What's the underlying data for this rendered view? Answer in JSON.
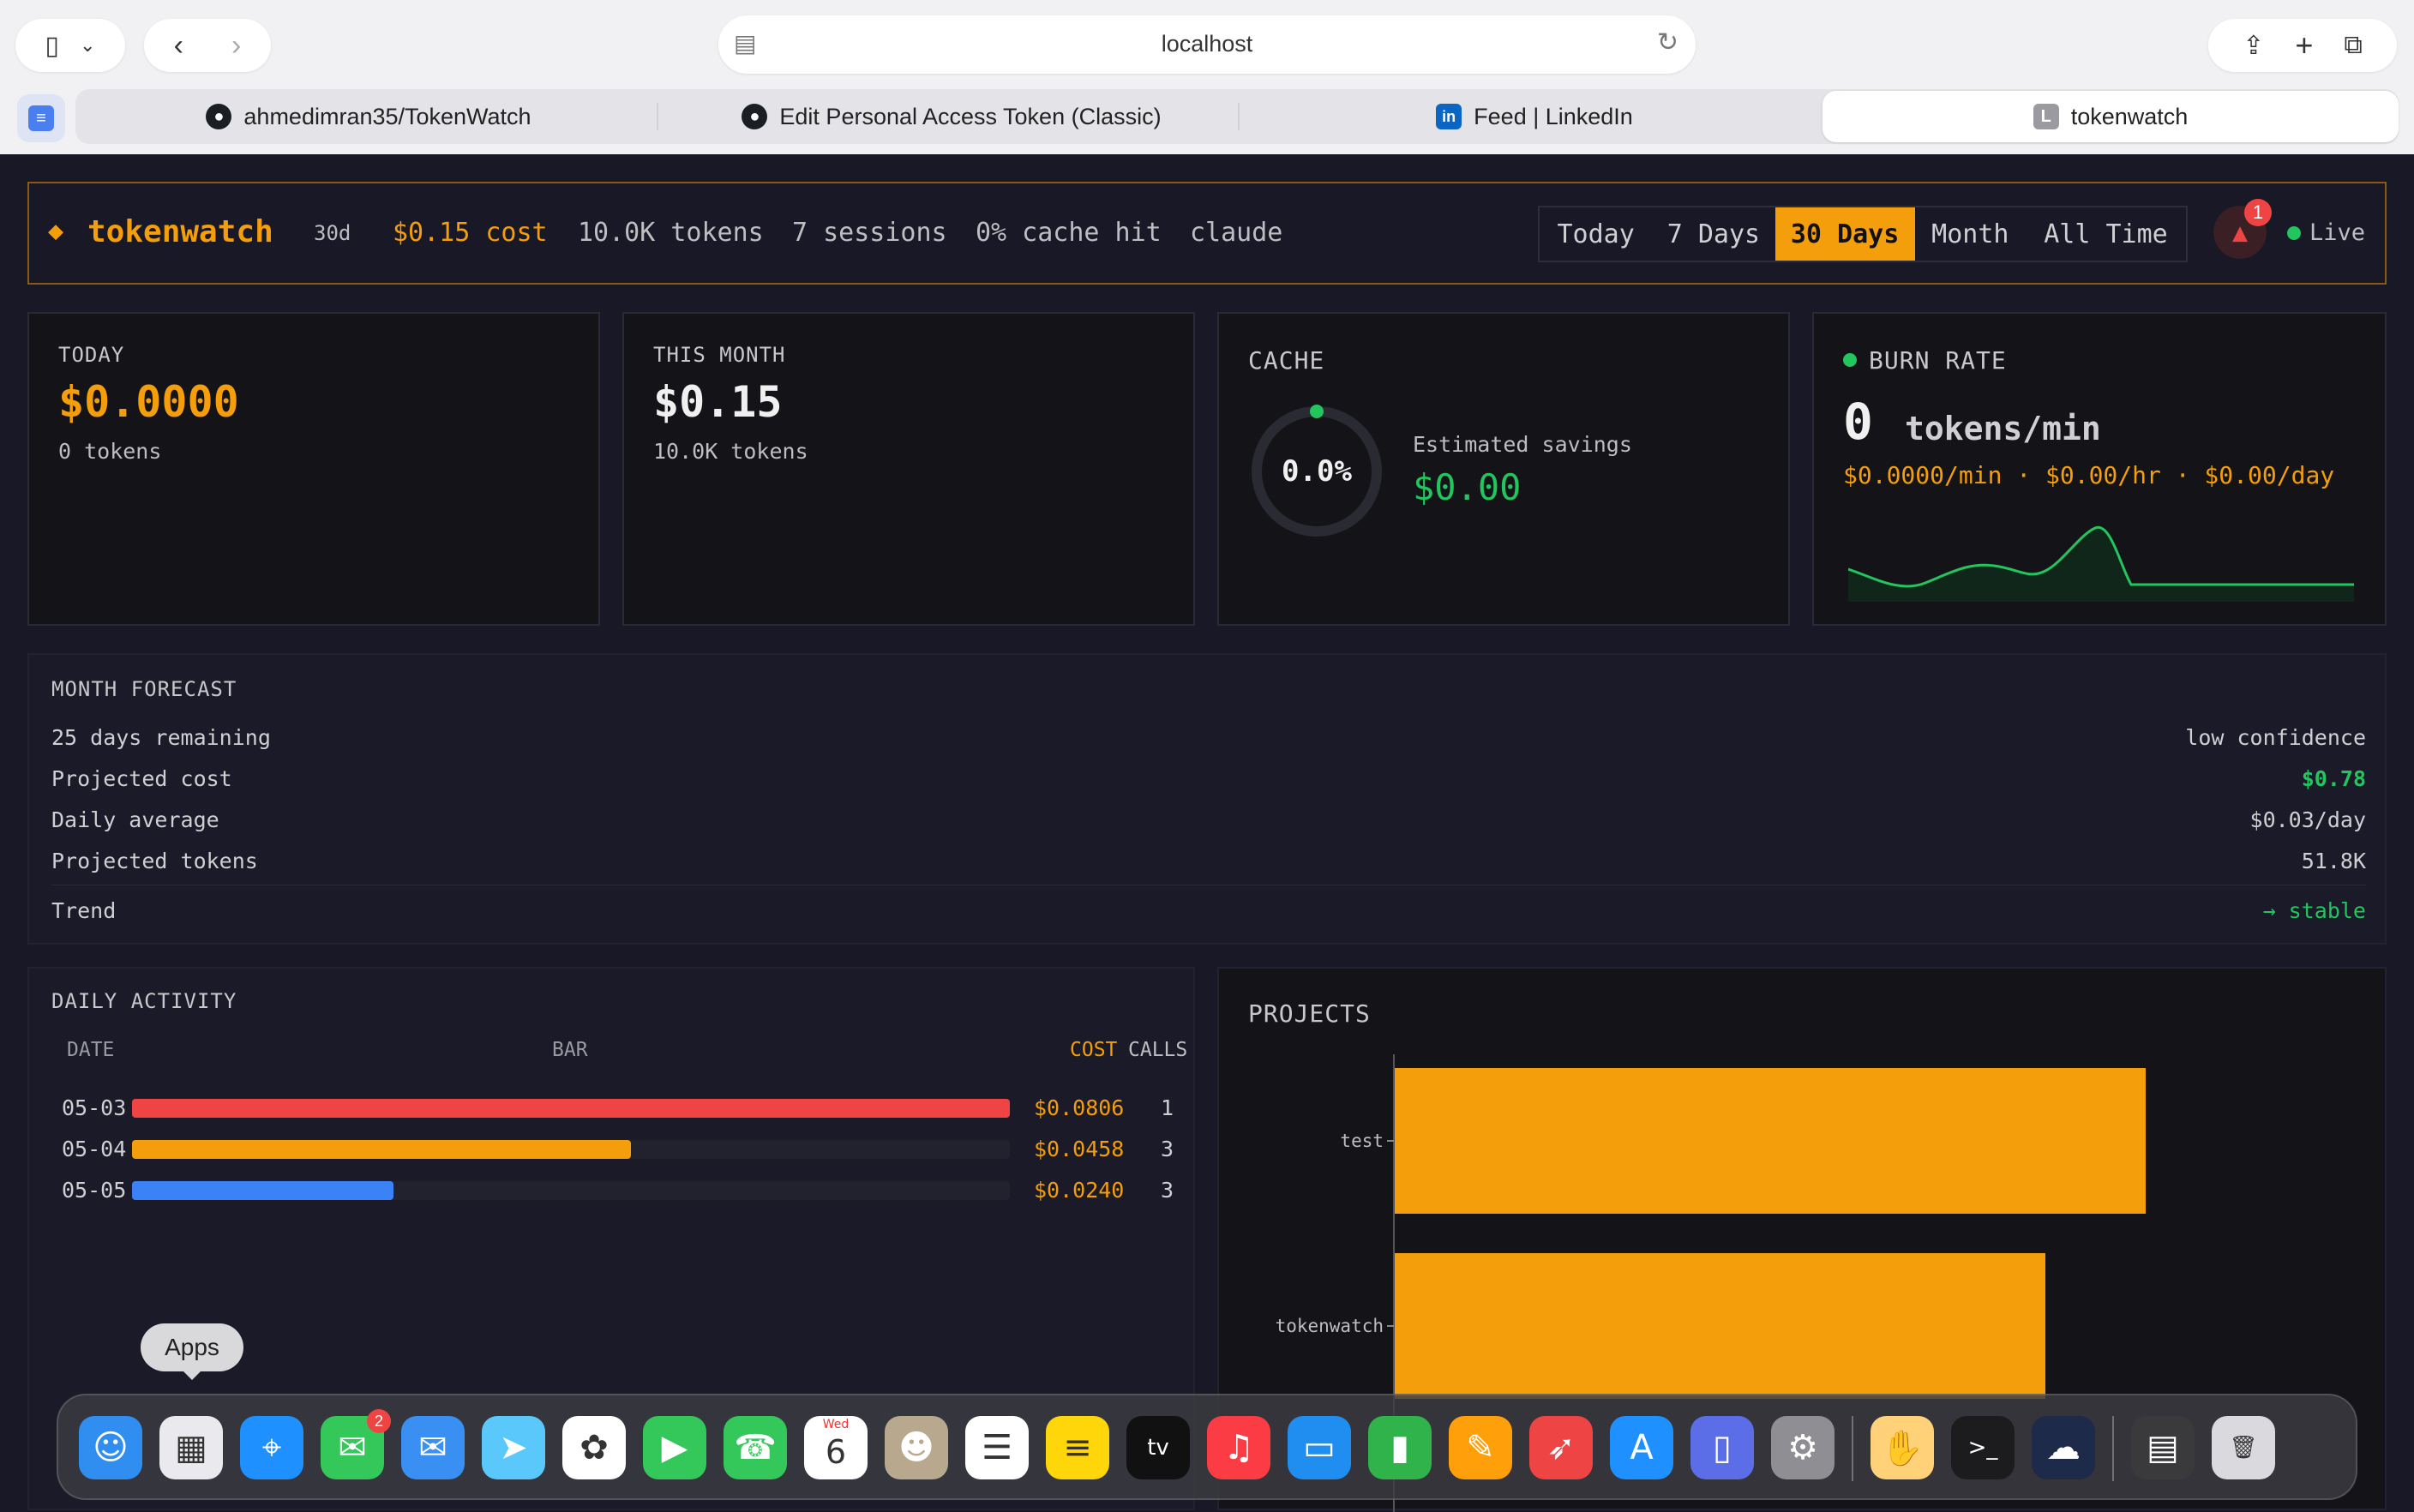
{
  "browser": {
    "url": "localhost",
    "tabs": [
      {
        "label": "ahmedimran35/TokenWatch",
        "icon": "github-icon"
      },
      {
        "label": "Edit Personal Access Token (Classic)",
        "icon": "github-icon"
      },
      {
        "label": "Feed | LinkedIn",
        "icon": "linkedin-icon"
      },
      {
        "label": "tokenwatch",
        "icon": "letter-l-icon",
        "icon_letter": "L",
        "active": true
      }
    ]
  },
  "header": {
    "logo_symbol": "◆",
    "brand": "tokenwatch",
    "period": "30d",
    "cost": "$0.15 cost",
    "tokens": "10.0K tokens",
    "sessions": "7 sessions",
    "cache_hit": "0% cache hit",
    "provider": "claude",
    "ranges": [
      "Today",
      "7 Days",
      "30 Days",
      "Month",
      "All Time"
    ],
    "active_range": "30 Days",
    "alert_count": "1",
    "live_label": "Live"
  },
  "cards": {
    "today": {
      "label": "TODAY",
      "value": "$0.0000",
      "sub": "0 tokens"
    },
    "month": {
      "label": "THIS MONTH",
      "value": "$0.15",
      "sub": "10.0K tokens"
    },
    "cache": {
      "label": "CACHE",
      "gauge": "0.0%",
      "gauge_fraction": 0.0,
      "savings_label": "Estimated savings",
      "savings_value": "$0.00"
    },
    "burn": {
      "label": "BURN RATE",
      "value": "0",
      "unit": "tokens/min",
      "rates": "$0.0000/min · $0.00/hr · $0.00/day"
    }
  },
  "forecast": {
    "title": "MONTH FORECAST",
    "rows": [
      {
        "left": "25 days remaining",
        "right": "low confidence"
      },
      {
        "left": "Projected cost",
        "right": "$0.78"
      },
      {
        "left": "Daily average",
        "right": "$0.03/day"
      },
      {
        "left": "Projected tokens",
        "right": "51.8K"
      },
      {
        "left": "Trend",
        "right": "→ stable"
      }
    ]
  },
  "daily": {
    "title": "DAILY ACTIVITY",
    "columns": {
      "date": "DATE",
      "bar": "BAR",
      "cost": "COST",
      "calls": "CALLS"
    },
    "rows": [
      {
        "date": "05-03",
        "cost": "$0.0806",
        "calls": "1",
        "fraction": 1.0,
        "color": "#ef4444"
      },
      {
        "date": "05-04",
        "cost": "$0.0458",
        "calls": "3",
        "fraction": 0.568,
        "color": "#f59e0b"
      },
      {
        "date": "05-05",
        "cost": "$0.0240",
        "calls": "3",
        "fraction": 0.298,
        "color": "#3b82f6"
      }
    ]
  },
  "projects": {
    "title": "PROJECTS"
  },
  "chart_data": {
    "type": "bar",
    "orientation": "horizontal",
    "categories": [
      "test",
      "tokenwatch"
    ],
    "values": [
      1.0,
      0.867
    ],
    "color": "#f59e0b"
  },
  "colors": {
    "accent": "#f59e0b",
    "green": "#22c55e",
    "red": "#ef4444",
    "blue": "#3b82f6"
  },
  "dock": {
    "tooltip": "Apps",
    "apps": [
      {
        "name": "finder-icon",
        "glyph": "☺",
        "bg": "#2f8ef0"
      },
      {
        "name": "launchpad-icon",
        "glyph": "▦",
        "bg": "#e9e9ee"
      },
      {
        "name": "safari-icon",
        "glyph": "⌖",
        "bg": "#1e90ff"
      },
      {
        "name": "messages-icon",
        "glyph": "✉",
        "bg": "#34c759",
        "badge": "2"
      },
      {
        "name": "mail-icon",
        "glyph": "✉",
        "bg": "#3a8ff2"
      },
      {
        "name": "maps-icon",
        "glyph": "➤",
        "bg": "#5ac8fa"
      },
      {
        "name": "photos-icon",
        "glyph": "✿",
        "bg": "#ffffff"
      },
      {
        "name": "facetime-icon",
        "glyph": "▶",
        "bg": "#34c759"
      },
      {
        "name": "phone-icon",
        "glyph": "☎",
        "bg": "#34c759"
      },
      {
        "name": "calendar-icon",
        "glyph": "6",
        "bg": "#ffffff",
        "top": "Wed"
      },
      {
        "name": "contacts-icon",
        "glyph": "☻",
        "bg": "#b8a98e"
      },
      {
        "name": "reminders-icon",
        "glyph": "☰",
        "bg": "#ffffff"
      },
      {
        "name": "notes-icon",
        "glyph": "≡",
        "bg": "#ffd60a"
      },
      {
        "name": "tv-icon",
        "glyph": "tv",
        "bg": "#111111"
      },
      {
        "name": "music-icon",
        "glyph": "♫",
        "bg": "#fc3c44"
      },
      {
        "name": "keynote-icon",
        "glyph": "▭",
        "bg": "#1f8ef0"
      },
      {
        "name": "numbers-icon",
        "glyph": "▮",
        "bg": "#2fb34a"
      },
      {
        "name": "pages-icon",
        "glyph": "✎",
        "bg": "#ff9f0a"
      },
      {
        "name": "rocket-icon",
        "glyph": "➶",
        "bg": "#ef4444"
      },
      {
        "name": "app-store-icon",
        "glyph": "A",
        "bg": "#1e90ff"
      },
      {
        "name": "simulator-icon",
        "glyph": "▯",
        "bg": "#5b6ee8"
      },
      {
        "name": "settings-icon",
        "glyph": "⚙",
        "bg": "#8e8e93"
      },
      {
        "name": "hand-icon",
        "glyph": "✋",
        "bg": "#ffd27a"
      },
      {
        "name": "terminal-icon",
        "glyph": ">_",
        "bg": "#1c1c1e"
      },
      {
        "name": "cloud-icon",
        "glyph": "☁",
        "bg": "#1e2a4a"
      },
      {
        "name": "folder-icon",
        "glyph": "▤",
        "bg": "#3a3a3c"
      },
      {
        "name": "trash-icon",
        "glyph": "🗑",
        "bg": "#d9d9de"
      }
    ]
  }
}
